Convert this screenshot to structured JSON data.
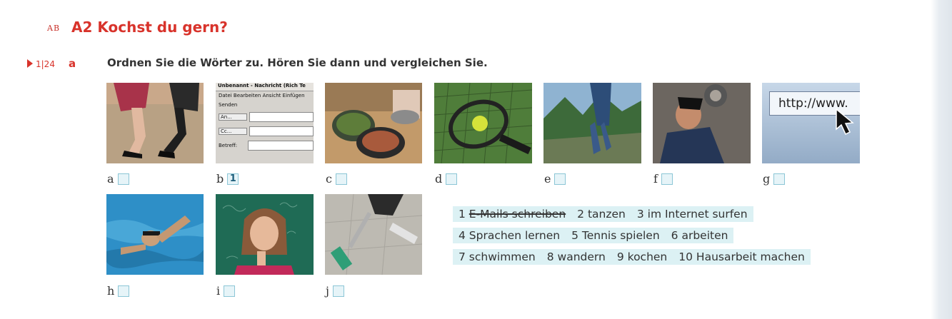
{
  "header": {
    "tag": "AB",
    "title": "A2 Kochst du gern?"
  },
  "exercise": {
    "track": "1|24",
    "letter": "a",
    "instruction": "Ordnen Sie die Wörter zu. Hören Sie dann und vergleichen Sie."
  },
  "photos": [
    {
      "label": "a",
      "answer": ""
    },
    {
      "label": "b",
      "answer": "1"
    },
    {
      "label": "c",
      "answer": ""
    },
    {
      "label": "d",
      "answer": ""
    },
    {
      "label": "e",
      "answer": ""
    },
    {
      "label": "f",
      "answer": ""
    },
    {
      "label": "g",
      "answer": ""
    },
    {
      "label": "h",
      "answer": ""
    },
    {
      "label": "i",
      "answer": ""
    },
    {
      "label": "j",
      "answer": ""
    }
  ],
  "screenshot_photo": {
    "window_title": "Unbenannt - Nachricht (Rich Te",
    "menu": "Datei  Bearbeiten  Ansicht  Einfügen",
    "send": "Senden",
    "to": "An...",
    "cc": "Cc...",
    "subject": "Betreff:"
  },
  "url_photo": {
    "text": "http://www."
  },
  "word_bank": {
    "row1": [
      "1 E-Mails schreiben",
      "2 tanzen",
      "3 im Internet surfen"
    ],
    "row2": [
      "4 Sprachen lernen",
      "5 Tennis spielen",
      "6 arbeiten"
    ],
    "row3": [
      "7 schwimmen",
      "8 wandern",
      "9 kochen",
      "10 Hausarbeit machen"
    ]
  }
}
